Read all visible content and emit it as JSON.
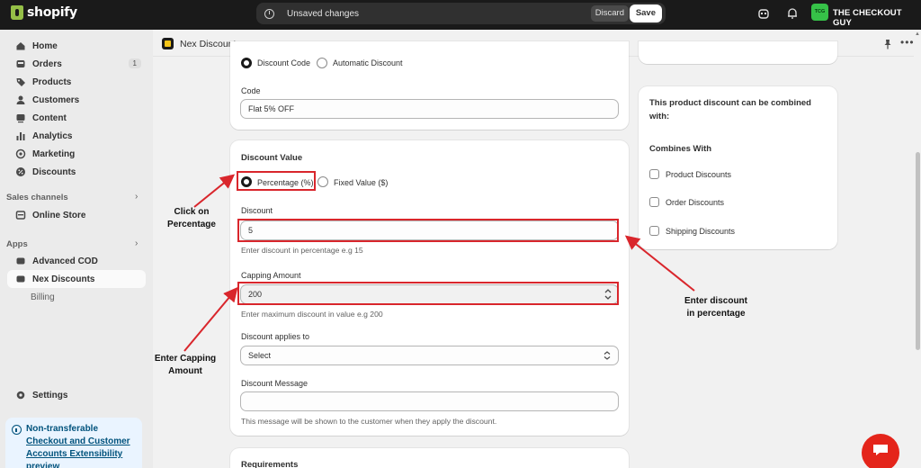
{
  "topbar": {
    "logo_text": "shopify",
    "unsaved_text": "Unsaved changes",
    "discard_label": "Discard",
    "save_label": "Save",
    "store_initials": "TCG",
    "store_name": "THE CHECKOUT GUY"
  },
  "sidebar": {
    "items": [
      {
        "label": "Home",
        "icon": "home-icon"
      },
      {
        "label": "Orders",
        "icon": "inbox-icon",
        "badge": "1"
      },
      {
        "label": "Products",
        "icon": "tag-icon"
      },
      {
        "label": "Customers",
        "icon": "person-icon"
      },
      {
        "label": "Content",
        "icon": "content-icon"
      },
      {
        "label": "Analytics",
        "icon": "bar-chart-icon"
      },
      {
        "label": "Marketing",
        "icon": "target-icon"
      },
      {
        "label": "Discounts",
        "icon": "discount-icon"
      }
    ],
    "sales_channels_title": "Sales channels",
    "online_store_label": "Online Store",
    "apps_title": "Apps",
    "apps": [
      {
        "label": "Advanced COD"
      },
      {
        "label": "Nex Discounts"
      }
    ],
    "billing_label": "Billing",
    "settings_label": "Settings",
    "notice": {
      "title": "Non-transferable",
      "link_line1": "Checkout and Customer",
      "link_line2": "Accounts Extensibility",
      "link_line3": "preview"
    }
  },
  "app_header": {
    "title": "Nex Discounts"
  },
  "discount_type": {
    "options": [
      "Discount Code",
      "Automatic Discount"
    ],
    "selected": "Discount Code"
  },
  "code": {
    "label": "Code",
    "value": "Flat 5% OFF"
  },
  "discount_value": {
    "title": "Discount Value",
    "options": [
      "Percentage (%)",
      "Fixed Value ($)"
    ],
    "selected": "Percentage (%)",
    "discount_label": "Discount",
    "discount_value": "5",
    "discount_hint": "Enter discount in percentage e.g 15",
    "capping_label": "Capping Amount",
    "capping_value": "200",
    "capping_hint": "Enter maximum discount in value e.g 200",
    "applies_label": "Discount applies to",
    "applies_value": "Select",
    "message_label": "Discount Message",
    "message_value": "",
    "message_hint": "This message will be shown to the customer when they apply the discount."
  },
  "requirements": {
    "title": "Requirements"
  },
  "combine_card": {
    "title_line1": "This product discount can be combined",
    "title_line2": "with:",
    "subtitle": "Combines With",
    "options": [
      "Product Discounts",
      "Order Discounts",
      "Shipping Discounts"
    ]
  },
  "annotations": {
    "click_percentage_line1": "Click on",
    "click_percentage_line2": "Percentage",
    "enter_discount_line1": "Enter discount",
    "enter_discount_line2": "in percentage",
    "enter_capping_line1": "Enter Capping",
    "enter_capping_line2": "Amount"
  },
  "colors": {
    "annotation_red": "#d9262c",
    "topbar": "#1a1a1a",
    "store_badge": "#36c148",
    "notice_text": "#00527c"
  }
}
